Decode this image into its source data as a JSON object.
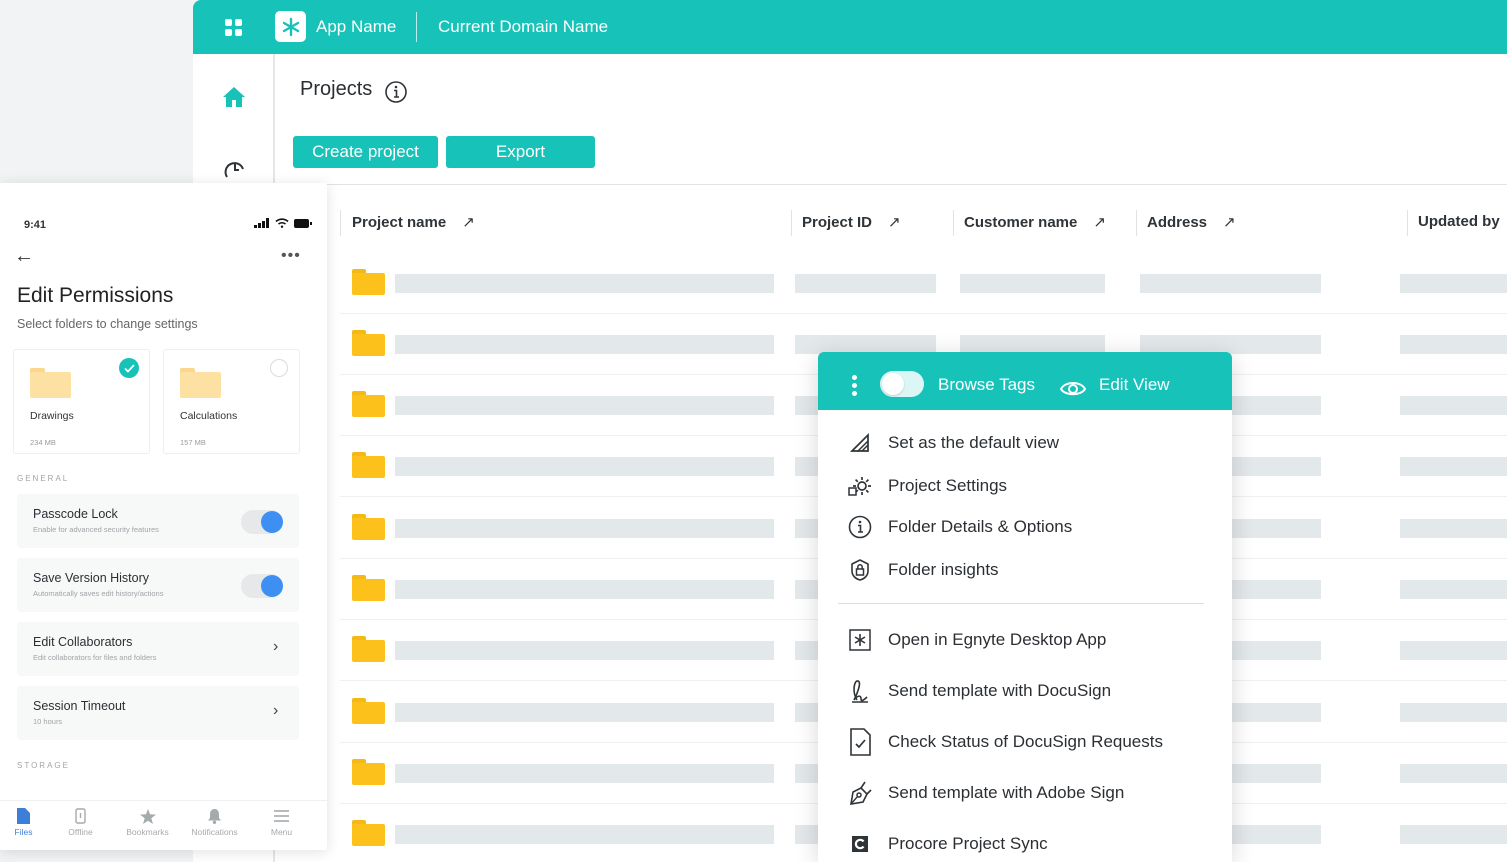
{
  "topbar": {
    "app_name": "App Name",
    "domain_name": "Current Domain Name"
  },
  "page": {
    "title": "Projects",
    "create_label": "Create project",
    "export_label": "Export"
  },
  "table": {
    "columns": [
      "Project name",
      "Project ID",
      "Customer name",
      "Address",
      "Updated by"
    ]
  },
  "mobile": {
    "time": "9:41",
    "title": "Edit Permissions",
    "subtitle": "Select folders to change settings",
    "folders": [
      {
        "name": "Drawings",
        "size": "234 MB",
        "selected": true
      },
      {
        "name": "Calculations",
        "size": "157 MB",
        "selected": false
      }
    ],
    "section_general": "GENERAL",
    "section_storage": "STORAGE",
    "settings": [
      {
        "title": "Passcode Lock",
        "sub": "Enable for advanced security features"
      },
      {
        "title": "Save Version History",
        "sub": "Automatically saves edit history/actions"
      },
      {
        "title": "Edit Collaborators",
        "sub": "Edit collaborators for files and folders"
      },
      {
        "title": "Session Timeout",
        "sub": "10 hours"
      }
    ],
    "nav": [
      "Files",
      "Offline",
      "Bookmarks",
      "Notifications",
      "Menu"
    ]
  },
  "menu": {
    "browse_tags": "Browse Tags",
    "edit_view": "Edit View",
    "items": [
      {
        "label": "Set as the default view",
        "icon": "default-view-icon"
      },
      {
        "label": "Project Settings",
        "icon": "settings-icon"
      },
      {
        "label": "Folder Details & Options",
        "icon": "info-icon"
      },
      {
        "label": "Folder insights",
        "icon": "lock-shield-icon"
      },
      {
        "label": "Open in Egnyte Desktop App",
        "icon": "desktop-app-icon"
      },
      {
        "label": "Send template with DocuSign",
        "icon": "signature-icon"
      },
      {
        "label": "Check Status of DocuSign Requests",
        "icon": "document-check-icon"
      },
      {
        "label": "Send template with Adobe Sign",
        "icon": "adobe-sign-icon"
      },
      {
        "label": "Procore Project Sync",
        "icon": "procore-icon"
      }
    ]
  },
  "colors": {
    "accent": "#17c2b8",
    "folder": "#fcc21b",
    "toggle_on": "#3d8ff1"
  }
}
